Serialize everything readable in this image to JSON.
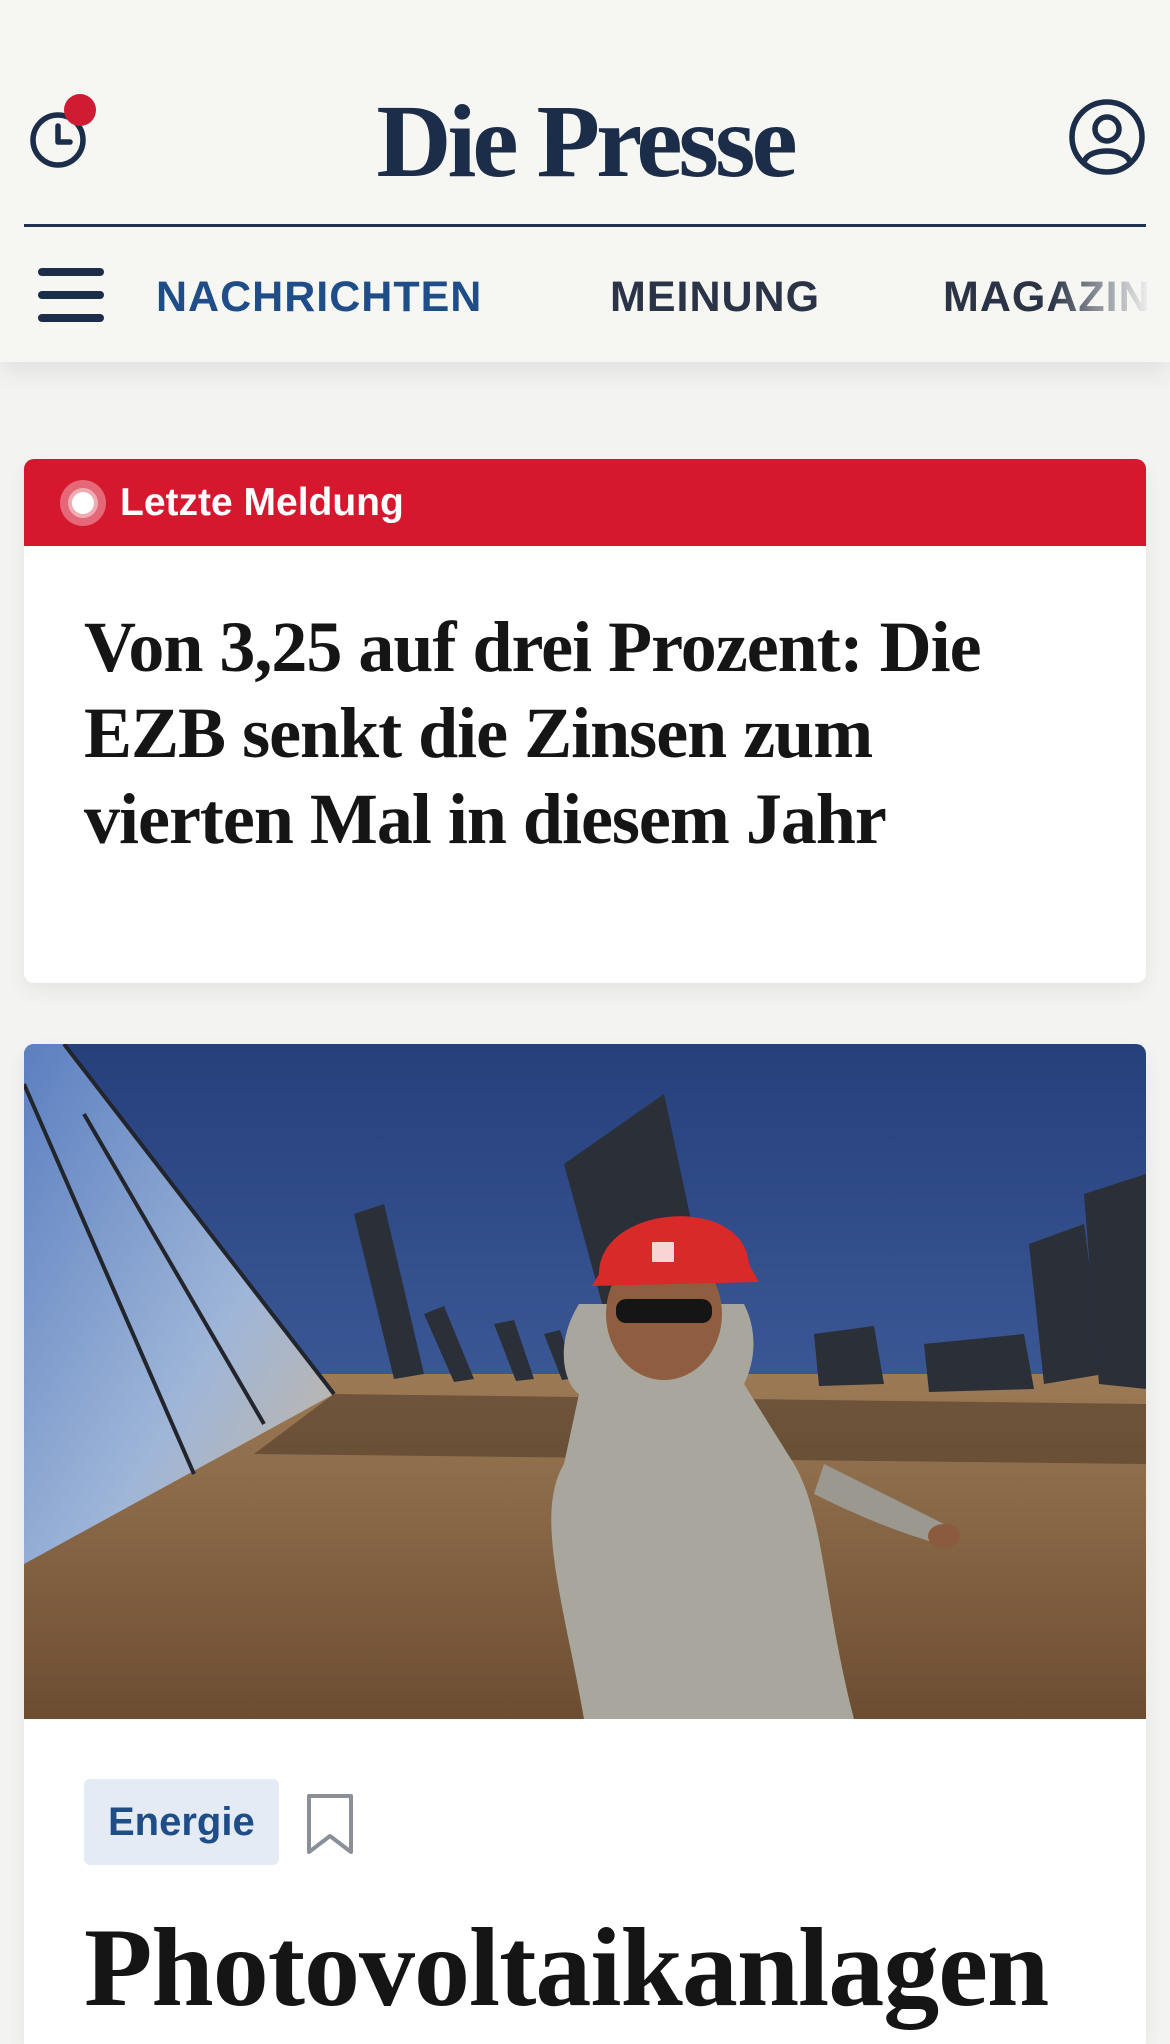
{
  "header": {
    "logo": "Die Presse",
    "history_icon": "history-clock-icon",
    "profile_icon": "user-profile-icon",
    "menu_icon": "hamburger-menu-icon",
    "nav": [
      "NACHRICHTEN",
      "MEINUNG",
      "MAGAZIN"
    ],
    "active_nav": "NACHRICHTEN"
  },
  "breaking": {
    "label": "Letzte Meldung",
    "headline": "Von 3,25 auf drei Prozent: Die EZB senkt die Zinsen zum vierten Mal in diesem Jahr",
    "icon": "live-dot-icon"
  },
  "teaser": {
    "image": "photo of a worker in a red helmet walking past solar mirror arrays in a desert",
    "category": "Energie",
    "bookmark_icon": "bookmark-icon",
    "headline": "Photovoltaikanlagen"
  },
  "colors": {
    "brand_navy": "#1c2d4a",
    "nav_active": "#1f4d87",
    "breaking_red": "#d6182f",
    "notification_red": "#d01c33",
    "tag_bg": "#e5ebf4",
    "page_bg": "#f3f3f1"
  }
}
